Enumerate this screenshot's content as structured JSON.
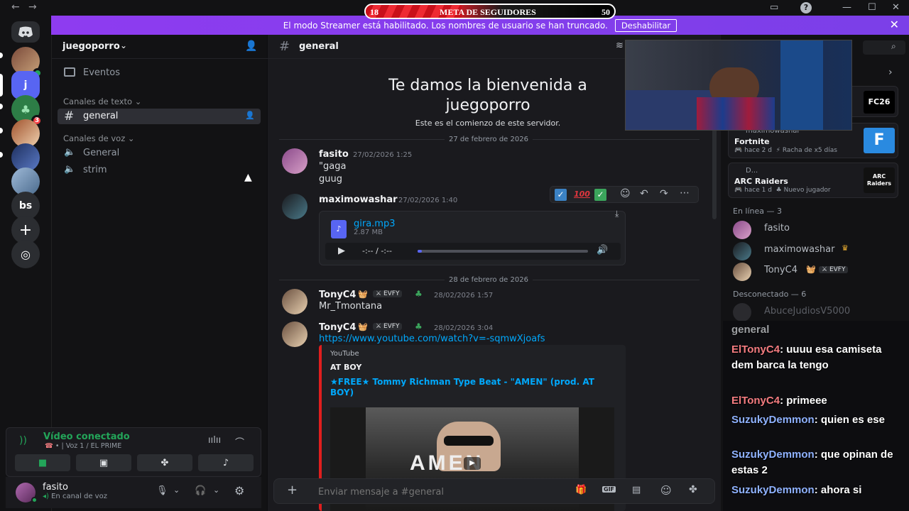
{
  "titlebar": {
    "back": "←",
    "forward": "→"
  },
  "goal": {
    "current": "18",
    "label": "META DE SEGUIDORES",
    "target": "50",
    "progress_fraction": 0.36
  },
  "banner": {
    "text": "El modo Streamer está habilitado. Los nombres de usuario se han truncado.",
    "button": "Deshabilitar"
  },
  "server_rail": {
    "items": [
      {
        "label": "",
        "color": "#5865f2"
      },
      {
        "label": "j",
        "color": "#5865f2"
      },
      {
        "label": "",
        "color": "#2d7d46",
        "badge": "3"
      },
      {
        "label": "",
        "color": "#8b5a3c"
      },
      {
        "label": "",
        "color": "#2a3b6b"
      },
      {
        "label": "",
        "color": "#6a86a6"
      },
      {
        "label": "bs",
        "color": "#2b2d31"
      }
    ]
  },
  "sidebar": {
    "server_name": "juegoporro",
    "events": "Eventos",
    "text_category": "Canales de texto",
    "text_channels": [
      "general"
    ],
    "voice_category": "Canales de voz",
    "voice_channels": [
      "General",
      "strim"
    ]
  },
  "voice": {
    "status": "Vídeo conectado",
    "location": "• | Voz 1 / EL PRIME"
  },
  "user": {
    "name": "fasito",
    "status": "En canal de voz"
  },
  "chat": {
    "channel": "general",
    "welcome_title": "Te damos la bienvenida a juegoporro",
    "welcome_sub": "Este es el comienzo de este servidor.",
    "date1": "27 de febrero de 2026",
    "date2": "28 de febrero de 2026",
    "messages": [
      {
        "author": "fasito",
        "time": "27/02/2026 1:25",
        "lines": [
          "\"gaga",
          "guug"
        ]
      },
      {
        "author": "maximowashar",
        "time": "27/02/2026 1:40",
        "file_name": "gira.mp3",
        "file_size": "2.87 MB",
        "audio_time": "-:-- / -:--"
      },
      {
        "author": "TonyC4",
        "tag": "EVFY",
        "time": "28/02/2026 1:57",
        "lines": [
          "Mr_Tmontana"
        ]
      },
      {
        "author": "TonyC4",
        "tag": "EVFY",
        "time": "28/02/2026 3:04",
        "link": "https://www.youtube.com/watch?v=-sqmwXjoafs",
        "embed_provider": "YouTube",
        "embed_author": "AT BOY",
        "embed_title": "★FREE★ Tommy Richman Type Beat - \"AMEN\" (prod. AT BOY)",
        "embed_thumb_text": "AMEN"
      }
    ],
    "composer_placeholder": "Enviar mensaje a #general"
  },
  "right": {
    "activities": [
      {
        "user": "maximowashar",
        "title": "Fortnite",
        "meta1": "hace 2 d",
        "meta2": "Racha de x5 días",
        "logo": "F"
      },
      {
        "user": "D...",
        "title": "ARC Raiders",
        "meta1": "hace 1 d",
        "meta2": "Nuevo jugador",
        "logo": "ARC Raiders"
      }
    ],
    "top_logo": "FC26",
    "online_header": "En línea — 3",
    "online": [
      "fasito",
      "maximowashar",
      "TonyC4"
    ],
    "online_tag": "EVFY",
    "offline_header": "Desconectado — 6",
    "offline": [
      "AbuceJudiosV5000"
    ]
  },
  "overlay_chat": [
    {
      "user": "",
      "text": "general"
    },
    {
      "user": "ElTonyC4",
      "text": ": uuuu esa camiseta dem barca la tengo",
      "color": "red"
    },
    {
      "user": "ElTonyC4",
      "text": ": primeee",
      "color": "red"
    },
    {
      "user": "SuzukyDemmon",
      "text": ": quien es ese",
      "color": "blue"
    },
    {
      "user": "SuzukyDemmon",
      "text": ": que opinan de estas 2",
      "color": "blue"
    },
    {
      "user": "SuzukyDemmon",
      "text": ": ahora si",
      "color": "blue"
    }
  ]
}
